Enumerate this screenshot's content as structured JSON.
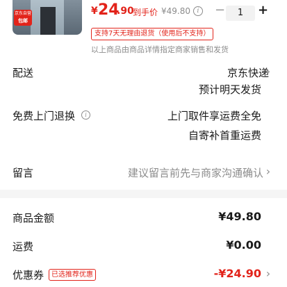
{
  "product": {
    "badge_line1": "京东自营",
    "badge_line2": "包邮",
    "price_symbol": "¥",
    "price_integer": "24",
    "price_decimal": ".90",
    "hand_price_label": "到手价",
    "original_price": "¥49.80",
    "quantity": "1",
    "minus_symbol": "−",
    "plus_symbol": "+",
    "return_tag": "支持7天无理由退货（使用后不支持）",
    "seller_note": "以上商品由商品详情指定商家销售和发货"
  },
  "delivery": {
    "label": "配送",
    "carrier": "京东快递",
    "eta": "预计明天发货"
  },
  "free_return": {
    "label": "免费上门退换",
    "line1": "上门取件享运费全免",
    "line2": "自寄补首重运费"
  },
  "message": {
    "label": "留言",
    "placeholder": "建议留言前先与商家沟通确认"
  },
  "summary": {
    "goods_amount_label": "商品金额",
    "goods_amount": "¥49.80",
    "shipping_label": "运费",
    "shipping": "¥0.00",
    "coupon_label": "优惠券",
    "coupon_chip": "已选推荐优惠",
    "coupon_amount": "-¥24.90"
  },
  "icons": {
    "chevron": "›",
    "info": "i"
  },
  "colors": {
    "accent": "#e2231a",
    "muted": "#8c8c8c",
    "divider": "#f5f5f5"
  }
}
